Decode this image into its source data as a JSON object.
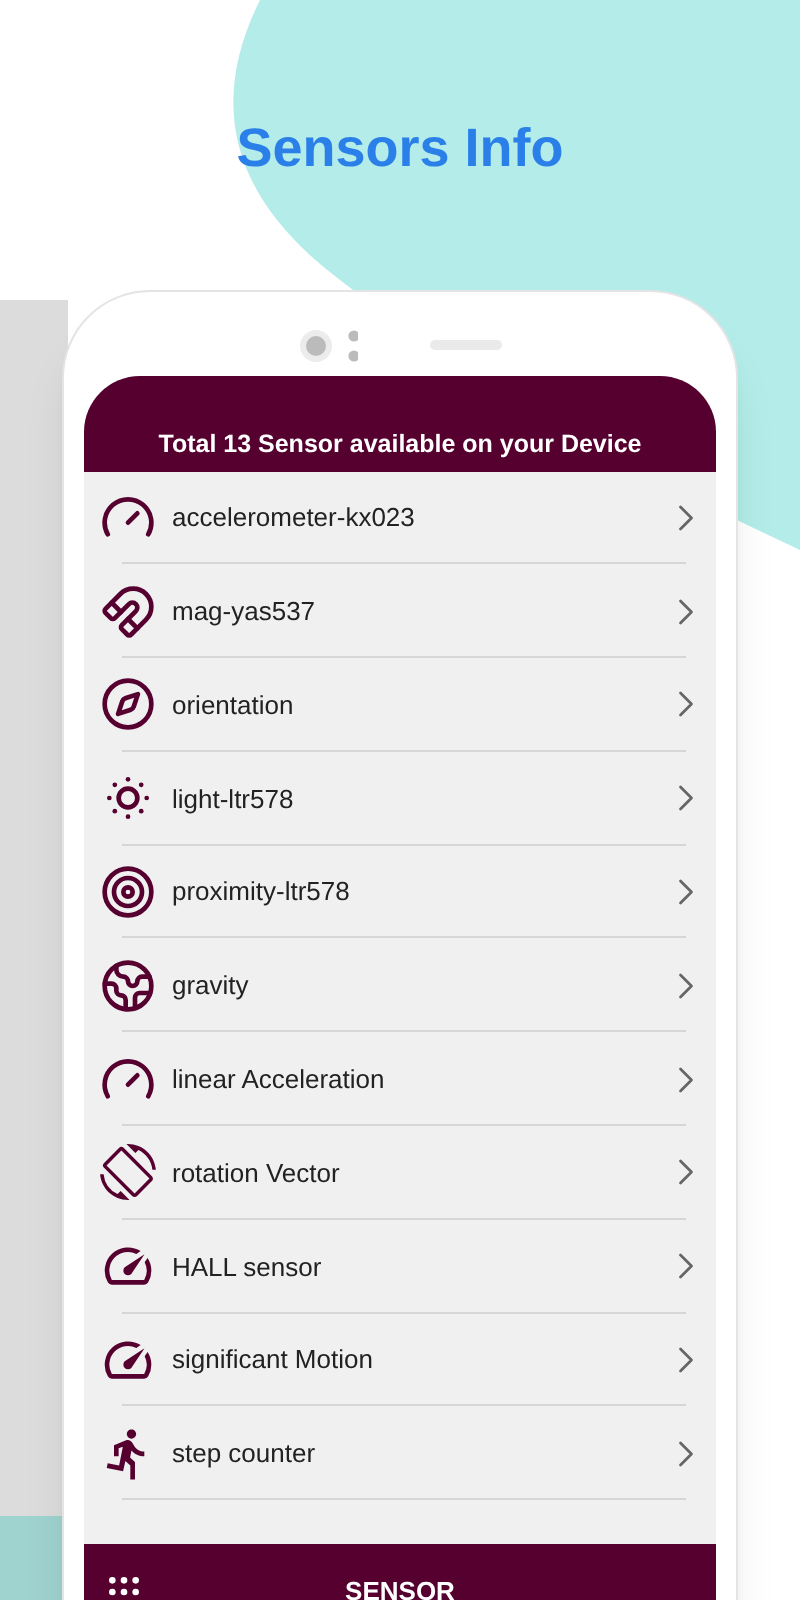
{
  "headline": "Sensors Info",
  "header": {
    "title": "Total 13 Sensor available on your Device"
  },
  "sensors": [
    {
      "name": "accelerometer-kx023"
    },
    {
      "name": "mag-yas537"
    },
    {
      "name": "orientation"
    },
    {
      "name": "light-ltr578"
    },
    {
      "name": "proximity-ltr578"
    },
    {
      "name": "gravity"
    },
    {
      "name": "linear Acceleration"
    },
    {
      "name": "rotation Vector"
    },
    {
      "name": "HALL sensor"
    },
    {
      "name": "significant Motion"
    },
    {
      "name": "step counter"
    }
  ],
  "bottom_bar": {
    "title": "SENSOR"
  }
}
